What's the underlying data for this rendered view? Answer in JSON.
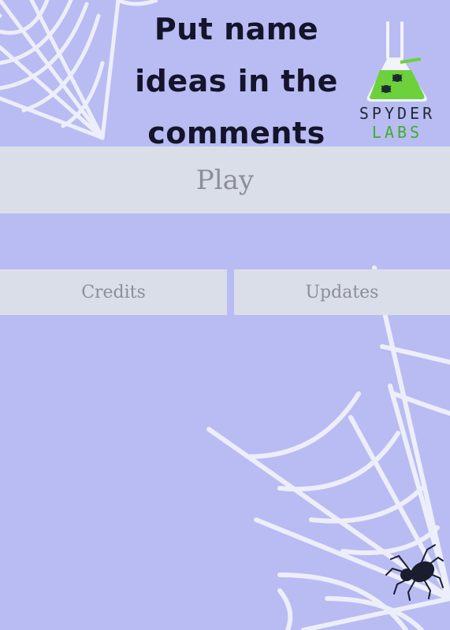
{
  "header": {
    "title_lines": [
      "Put name",
      "ideas in the",
      "comments"
    ]
  },
  "logo": {
    "line1": "SPYDER",
    "line2": "LABS"
  },
  "menu": {
    "play_label": "Play",
    "credits_label": "Credits",
    "updates_label": "Updates"
  },
  "colors": {
    "background": "#b9bcf2",
    "button": "#dadee9",
    "button_text": "#8c8e99",
    "web": "#eceef9",
    "potion": "#6cd13b",
    "title_text": "#14142a"
  },
  "icons": [
    "spider-web-icon",
    "flask-logo-icon",
    "spider-icon"
  ]
}
